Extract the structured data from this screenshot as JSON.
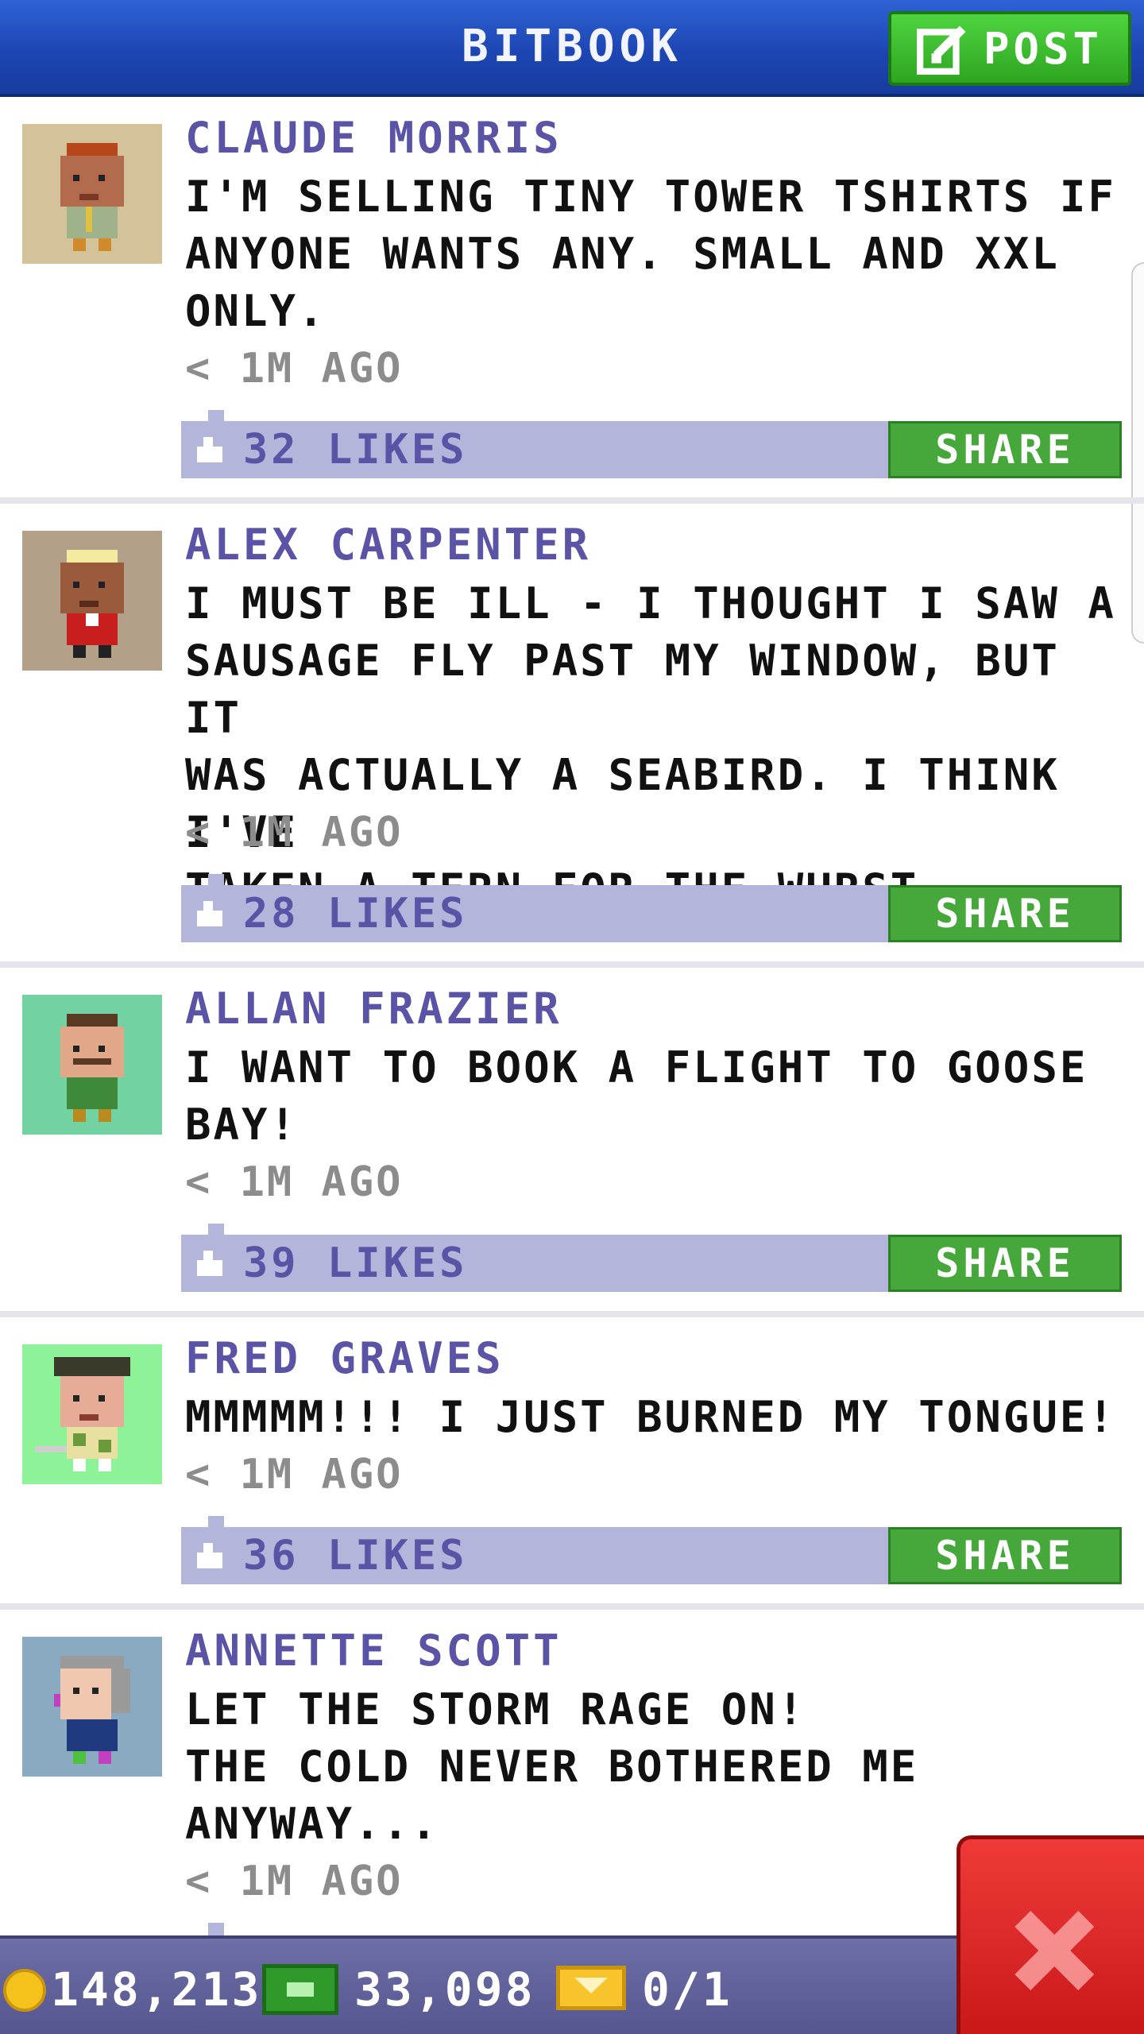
{
  "header": {
    "title": "BITBOOK",
    "post_label": "POST"
  },
  "colors": {
    "header_blue": "#1d46b3",
    "post_green": "#3dbf30",
    "name_purple": "#5b54a6",
    "like_bar": "#b4b5da",
    "share_green": "#46a83a",
    "close_red": "#e02a2a"
  },
  "posts": [
    {
      "author": "CLAUDE MORRIS",
      "text": "I'M SELLING TINY TOWER TSHIRTS IF\nANYONE WANTS ANY. SMALL AND XXL\nONLY.",
      "time": "< 1M AGO",
      "likes": "32 LIKES",
      "share_label": "SHARE",
      "avatar_icon": "bitizen-avatar-claude"
    },
    {
      "author": "ALEX CARPENTER",
      "text": "I MUST BE ILL - I THOUGHT I SAW A\nSAUSAGE FLY PAST MY WINDOW, BUT IT\nWAS ACTUALLY A SEABIRD. I THINK I'VE\nTAKEN A TERN FOR THE WURST.",
      "time": "< 1M AGO",
      "likes": "28 LIKES",
      "share_label": "SHARE",
      "avatar_icon": "bitizen-avatar-alex"
    },
    {
      "author": "ALLAN FRAZIER",
      "text": "I WANT TO BOOK A FLIGHT TO GOOSE\nBAY!",
      "time": "< 1M AGO",
      "likes": "39 LIKES",
      "share_label": "SHARE",
      "avatar_icon": "bitizen-avatar-allan"
    },
    {
      "author": "FRED GRAVES",
      "text": "MMMMM!!! I JUST BURNED MY TONGUE!",
      "time": "< 1M AGO",
      "likes": "36 LIKES",
      "share_label": "SHARE",
      "avatar_icon": "bitizen-avatar-fred"
    },
    {
      "author": "ANNETTE SCOTT",
      "text": "LET THE STORM RAGE ON!\nTHE COLD NEVER BOTHERED ME\nANYWAY...",
      "time": "< 1M AGO",
      "avatar_icon": "bitizen-avatar-annette"
    }
  ],
  "status_bar": {
    "coins": "148,213",
    "bux": "33,098",
    "tickets": "0/1"
  },
  "icons": [
    "coin-icon",
    "bux-icon",
    "golden-ticket-icon",
    "close-icon",
    "compose-icon",
    "thumbs-up-icon"
  ]
}
